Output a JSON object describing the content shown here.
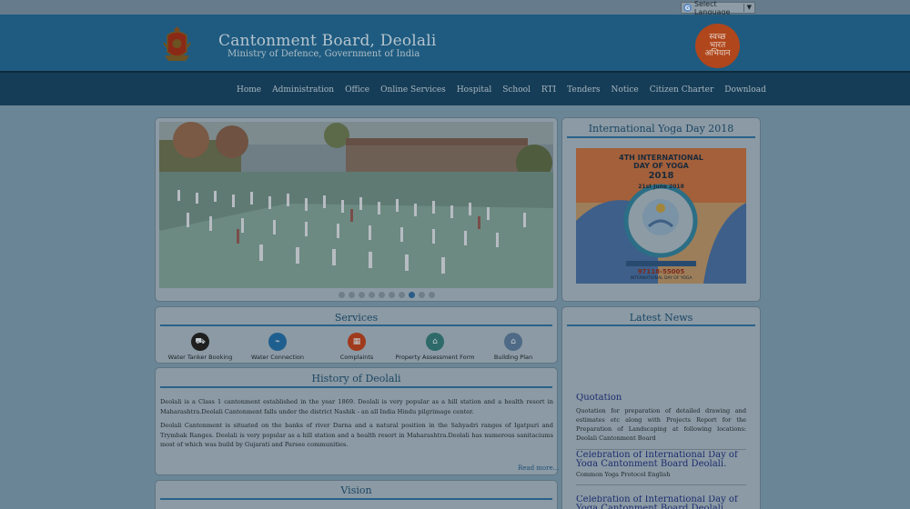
{
  "language": {
    "selector_label": "Select Language"
  },
  "header": {
    "title": "Cantonment Board, Deolali",
    "subtitle": "Ministry of Defence, Government of India",
    "badge_text": [
      "स्वच्छ",
      "भारत",
      "अभियान"
    ]
  },
  "nav": {
    "items": [
      "Home",
      "Administration",
      "Office",
      "Online Services",
      "Hospital",
      "School",
      "RTI",
      "Tenders",
      "Notice",
      "Citizen Charter",
      "Download"
    ]
  },
  "slider": {
    "dot_count": 10,
    "active_index": 7
  },
  "yoga": {
    "title": "International Yoga Day 2018",
    "poster_line1": "4TH INTERNATIONAL",
    "poster_line2": "DAY OF YOGA",
    "poster_year": "2018",
    "poster_date": "21st June 2018",
    "poster_phone": "97118-55005",
    "poster_footer": "INTERNATIONAL DAY OF YOGA"
  },
  "services": {
    "title": "Services",
    "items": [
      {
        "label": "Water Tanker Booking",
        "icon": "truck-icon",
        "color": "#1f1f1f"
      },
      {
        "label": "Water Connection",
        "icon": "tap-icon",
        "color": "#1f5f8f"
      },
      {
        "label": "Complaints",
        "icon": "building-icon",
        "color": "#a03a1c"
      },
      {
        "label": "Property Assessment Form",
        "icon": "property-icon",
        "color": "#2e6a6a"
      },
      {
        "label": "Building Plan",
        "icon": "house-icon",
        "color": "#4f6a86"
      }
    ]
  },
  "history": {
    "title": "History of Deolali",
    "p1": "Deolali is a Class 1 cantonment established in the year 1869. Deolali is very popular as a hill station and a health resort in Maharashtra.Deolali Cantonment falls under the district Nashik - an all India Hindu pilgrimage center.",
    "p2": "Deolali Cantonment is situated on the banks of river Darna and a natural position in the Sahyadri ranges of Igatpuri and Trymbak Ranges. Deolali is very popular as a hill station and a health resort in Maharashtra.Deolali has numerous sanitaciums most of which was build by Gujarati and Parsee communities.",
    "read_more": "Read more..."
  },
  "vision": {
    "title": "Vision"
  },
  "news": {
    "title": "Latest News",
    "items": [
      {
        "title": "Quotation",
        "text": "Quotation for preparation of detailed drawing and estimates etc along with Projects Report for the Preparation of Landscaping at following locations: Deolali Cantonment Board"
      },
      {
        "title": "Celebration of International Day of Yoga Cantonment Board Deolali.",
        "text": "Common Yoga Protocol English"
      },
      {
        "title": "Celebration of International Day of Yoga Cantonment Board Deolali.",
        "text": ""
      }
    ]
  }
}
